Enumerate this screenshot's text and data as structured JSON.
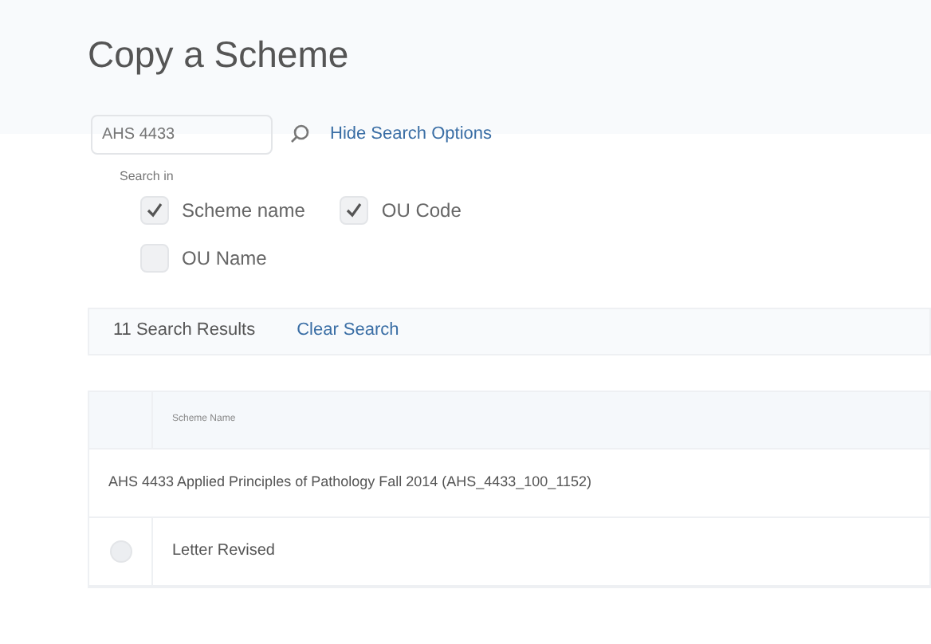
{
  "title": "Copy a Scheme",
  "search": {
    "value": "AHS 4433",
    "toggle_link": "Hide Search Options"
  },
  "search_in": {
    "label": "Search in",
    "options": [
      {
        "label": "Scheme name",
        "checked": true
      },
      {
        "label": "OU Code",
        "checked": true
      },
      {
        "label": "OU Name",
        "checked": false
      }
    ]
  },
  "results_bar": {
    "count": "11 Search Results",
    "clear_link": "Clear Search"
  },
  "table": {
    "columns": [
      "Scheme Name"
    ],
    "rows": [
      {
        "kind": "group",
        "text": "AHS 4433 Applied Principles of Pathology Fall 2014 (AHS_4433_100_1152)"
      },
      {
        "kind": "item",
        "text": "Letter Revised",
        "selected": false
      }
    ]
  }
}
